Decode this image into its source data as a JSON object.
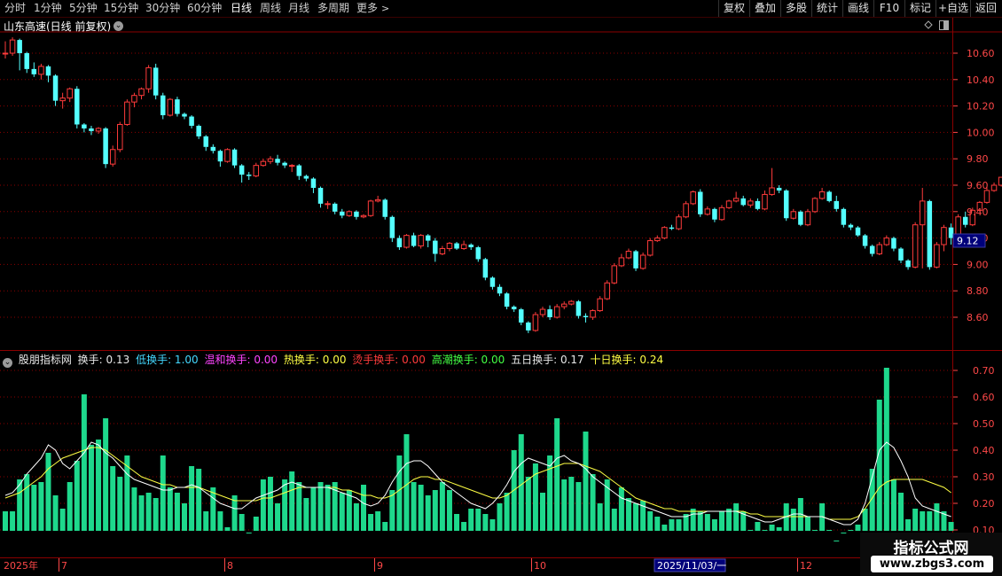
{
  "toolbar": {
    "periods": [
      {
        "label": "分时",
        "active": false
      },
      {
        "label": "1分钟",
        "active": false
      },
      {
        "label": "5分钟",
        "active": false
      },
      {
        "label": "15分钟",
        "active": false
      },
      {
        "label": "30分钟",
        "active": false
      },
      {
        "label": "60分钟",
        "active": false
      },
      {
        "label": "日线",
        "active": true
      },
      {
        "label": "周线",
        "active": false
      },
      {
        "label": "月线",
        "active": false
      },
      {
        "label": "多周期",
        "active": false
      },
      {
        "label": "更多",
        "active": false
      }
    ],
    "right_buttons": [
      "复权",
      "叠加",
      "多股",
      "统计",
      "画线",
      "F10",
      "标记",
      "+自选",
      "返回"
    ]
  },
  "stock": {
    "title": "山东高速(日线 前复权)"
  },
  "price_axis": {
    "ticks": [
      "10.60",
      "10.40",
      "10.20",
      "10.00",
      "9.80",
      "9.60",
      "9.40",
      "9.20",
      "9.00",
      "8.80",
      "8.60"
    ],
    "current_price": "9.12"
  },
  "indicator": {
    "name": "股朋指标网",
    "items": [
      {
        "label": "换手: 0.13",
        "color": "#e8e8e8"
      },
      {
        "label": "低换手: 1.00",
        "color": "#44d8ff"
      },
      {
        "label": "温和换手: 0.00",
        "color": "#ff44ff"
      },
      {
        "label": "热换手: 0.00",
        "color": "#ffff44"
      },
      {
        "label": "烫手换手: 0.00",
        "color": "#ff3b3b"
      },
      {
        "label": "高潮换手: 0.00",
        "color": "#44ff44"
      },
      {
        "label": "五日换手: 0.17",
        "color": "#e8e8e8"
      },
      {
        "label": "十日换手: 0.24",
        "color": "#ffff44"
      }
    ],
    "axis_ticks": [
      "0.70",
      "0.60",
      "0.50",
      "0.40",
      "0.30",
      "0.20",
      "0.10"
    ]
  },
  "time_axis": {
    "labels": [
      "2025年",
      "7",
      "8",
      "9",
      "10",
      "2025/11/03/一",
      "12"
    ]
  },
  "watermark": {
    "title": "指标公式网",
    "url": "www.zbgs3.com"
  },
  "colors": {
    "up": "#ff3b3b",
    "down": "#54ffff",
    "grid": "#8b0000",
    "axis_text": "#ff4848",
    "vol_bar": "#1ed88c",
    "ma5": "#ffffff",
    "ma10": "#ffff44"
  },
  "chart_data": {
    "type": "candlestick",
    "title": "山东高速(日线 前复权)",
    "price_ylim": [
      8.5,
      10.73
    ],
    "candles": [
      [
        10.6,
        10.6,
        10.69,
        10.56
      ],
      [
        10.6,
        10.7,
        10.72,
        10.58
      ],
      [
        10.7,
        10.6,
        10.71,
        10.47
      ],
      [
        10.6,
        10.48,
        10.61,
        10.45
      ],
      [
        10.48,
        10.44,
        10.53,
        10.42
      ],
      [
        10.44,
        10.5,
        10.52,
        10.4
      ],
      [
        10.5,
        10.43,
        10.51,
        10.38
      ],
      [
        10.43,
        10.24,
        10.44,
        10.2
      ],
      [
        10.24,
        10.26,
        10.3,
        10.18
      ],
      [
        10.26,
        10.33,
        10.34,
        10.23
      ],
      [
        10.33,
        10.06,
        10.35,
        10.03
      ],
      [
        10.06,
        10.03,
        10.07,
        10.0
      ],
      [
        10.03,
        10.01,
        10.05,
        9.98
      ],
      [
        10.01,
        10.03,
        10.04,
        9.99
      ],
      [
        10.03,
        9.76,
        10.04,
        9.73
      ],
      [
        9.76,
        9.87,
        9.9,
        9.74
      ],
      [
        9.87,
        10.06,
        10.08,
        9.85
      ],
      [
        10.06,
        10.23,
        10.25,
        10.05
      ],
      [
        10.23,
        10.28,
        10.3,
        10.19
      ],
      [
        10.28,
        10.33,
        10.34,
        10.25
      ],
      [
        10.33,
        10.49,
        10.51,
        10.3
      ],
      [
        10.49,
        10.28,
        10.52,
        10.25
      ],
      [
        10.28,
        10.13,
        10.3,
        10.1
      ],
      [
        10.13,
        10.25,
        10.26,
        10.12
      ],
      [
        10.25,
        10.14,
        10.27,
        10.12
      ],
      [
        10.14,
        10.12,
        10.15,
        10.1
      ],
      [
        10.12,
        10.05,
        10.13,
        10.03
      ],
      [
        10.05,
        9.97,
        10.06,
        9.95
      ],
      [
        9.97,
        9.89,
        9.98,
        9.86
      ],
      [
        9.89,
        9.86,
        9.91,
        9.84
      ],
      [
        9.86,
        9.78,
        9.87,
        9.74
      ],
      [
        9.78,
        9.87,
        9.88,
        9.77
      ],
      [
        9.87,
        9.75,
        9.88,
        9.73
      ],
      [
        9.75,
        9.68,
        9.76,
        9.62
      ],
      [
        9.68,
        9.67,
        9.7,
        9.64
      ],
      [
        9.67,
        9.75,
        9.77,
        9.66
      ],
      [
        9.75,
        9.78,
        9.8,
        9.74
      ],
      [
        9.78,
        9.8,
        9.82,
        9.76
      ],
      [
        9.8,
        9.77,
        9.83,
        9.75
      ],
      [
        9.77,
        9.75,
        9.78,
        9.73
      ],
      [
        9.75,
        9.75,
        9.76,
        9.7
      ],
      [
        9.75,
        9.67,
        9.76,
        9.64
      ],
      [
        9.67,
        9.65,
        9.68,
        9.63
      ],
      [
        9.65,
        9.58,
        9.66,
        9.54
      ],
      [
        9.58,
        9.46,
        9.59,
        9.43
      ],
      [
        9.46,
        9.46,
        9.48,
        9.42
      ],
      [
        9.46,
        9.4,
        9.47,
        9.38
      ],
      [
        9.4,
        9.37,
        9.42,
        9.35
      ],
      [
        9.37,
        9.4,
        9.41,
        9.36
      ],
      [
        9.4,
        9.36,
        9.41,
        9.34
      ],
      [
        9.36,
        9.37,
        9.38,
        9.35
      ],
      [
        9.37,
        9.48,
        9.49,
        9.36
      ],
      [
        9.48,
        9.49,
        9.52,
        9.47
      ],
      [
        9.49,
        9.36,
        9.5,
        9.34
      ],
      [
        9.36,
        9.2,
        9.37,
        9.17
      ],
      [
        9.2,
        9.13,
        9.22,
        9.11
      ],
      [
        9.13,
        9.22,
        9.23,
        9.12
      ],
      [
        9.22,
        9.14,
        9.24,
        9.13
      ],
      [
        9.14,
        9.22,
        9.23,
        9.12
      ],
      [
        9.22,
        9.18,
        9.23,
        9.13
      ],
      [
        9.18,
        9.08,
        9.2,
        9.02
      ],
      [
        9.08,
        9.12,
        9.14,
        9.07
      ],
      [
        9.12,
        9.16,
        9.17,
        9.1
      ],
      [
        9.16,
        9.12,
        9.17,
        9.11
      ],
      [
        9.12,
        9.15,
        9.18,
        9.11
      ],
      [
        9.15,
        9.13,
        9.16,
        9.11
      ],
      [
        9.13,
        9.04,
        9.14,
        9.02
      ],
      [
        9.04,
        8.9,
        9.05,
        8.88
      ],
      [
        8.9,
        8.83,
        8.91,
        8.81
      ],
      [
        8.83,
        8.78,
        8.85,
        8.76
      ],
      [
        8.78,
        8.68,
        8.79,
        8.66
      ],
      [
        8.68,
        8.66,
        8.69,
        8.64
      ],
      [
        8.66,
        8.56,
        8.67,
        8.54
      ],
      [
        8.56,
        8.5,
        8.57,
        8.48
      ],
      [
        8.5,
        8.62,
        8.64,
        8.49
      ],
      [
        8.62,
        8.66,
        8.68,
        8.6
      ],
      [
        8.66,
        8.6,
        8.69,
        8.58
      ],
      [
        8.6,
        8.68,
        8.7,
        8.59
      ],
      [
        8.68,
        8.7,
        8.72,
        8.66
      ],
      [
        8.7,
        8.72,
        8.73,
        8.69
      ],
      [
        8.72,
        8.61,
        8.73,
        8.59
      ],
      [
        8.61,
        8.6,
        8.63,
        8.56
      ],
      [
        8.6,
        8.65,
        8.66,
        8.58
      ],
      [
        8.65,
        8.74,
        8.76,
        8.64
      ],
      [
        8.74,
        8.86,
        8.88,
        8.73
      ],
      [
        8.86,
        8.99,
        9.01,
        8.85
      ],
      [
        8.99,
        9.05,
        9.08,
        8.98
      ],
      [
        9.05,
        9.1,
        9.12,
        9.04
      ],
      [
        9.1,
        8.97,
        9.11,
        8.95
      ],
      [
        8.97,
        9.07,
        9.09,
        8.96
      ],
      [
        9.07,
        9.18,
        9.2,
        9.06
      ],
      [
        9.18,
        9.2,
        9.22,
        9.17
      ],
      [
        9.2,
        9.28,
        9.29,
        9.19
      ],
      [
        9.28,
        9.27,
        9.3,
        9.26
      ],
      [
        9.27,
        9.36,
        9.38,
        9.26
      ],
      [
        9.36,
        9.46,
        9.48,
        9.35
      ],
      [
        9.46,
        9.55,
        9.56,
        9.45
      ],
      [
        9.55,
        9.38,
        9.57,
        9.36
      ],
      [
        9.38,
        9.42,
        9.44,
        9.37
      ],
      [
        9.42,
        9.34,
        9.43,
        9.32
      ],
      [
        9.34,
        9.43,
        9.45,
        9.33
      ],
      [
        9.43,
        9.48,
        9.49,
        9.42
      ],
      [
        9.48,
        9.5,
        9.55,
        9.47
      ],
      [
        9.5,
        9.45,
        9.52,
        9.44
      ],
      [
        9.45,
        9.48,
        9.5,
        9.43
      ],
      [
        9.48,
        9.42,
        9.5,
        9.41
      ],
      [
        9.42,
        9.53,
        9.56,
        9.41
      ],
      [
        9.53,
        9.58,
        9.73,
        9.52
      ],
      [
        9.58,
        9.56,
        9.6,
        9.54
      ],
      [
        9.56,
        9.35,
        9.57,
        9.33
      ],
      [
        9.35,
        9.4,
        9.42,
        9.34
      ],
      [
        9.4,
        9.3,
        9.41,
        9.29
      ],
      [
        9.3,
        9.4,
        9.42,
        9.29
      ],
      [
        9.4,
        9.5,
        9.51,
        9.39
      ],
      [
        9.5,
        9.55,
        9.58,
        9.49
      ],
      [
        9.55,
        9.48,
        9.56,
        9.47
      ],
      [
        9.48,
        9.42,
        9.52,
        9.4
      ],
      [
        9.42,
        9.3,
        9.43,
        9.28
      ],
      [
        9.3,
        9.28,
        9.31,
        9.26
      ],
      [
        9.28,
        9.22,
        9.29,
        9.21
      ],
      [
        9.22,
        9.14,
        9.23,
        9.12
      ],
      [
        9.14,
        9.08,
        9.15,
        9.06
      ],
      [
        9.08,
        9.15,
        9.17,
        9.07
      ],
      [
        9.15,
        9.2,
        9.22,
        9.14
      ],
      [
        9.2,
        9.12,
        9.21,
        9.1
      ],
      [
        9.12,
        9.03,
        9.13,
        9.01
      ],
      [
        9.03,
        8.98,
        9.04,
        8.96
      ],
      [
        8.98,
        9.3,
        9.32,
        8.97
      ],
      [
        9.3,
        9.48,
        9.58,
        8.97
      ],
      [
        9.48,
        8.98,
        9.49,
        8.96
      ],
      [
        8.98,
        9.15,
        9.17,
        8.97
      ],
      [
        9.15,
        9.28,
        9.3,
        9.1
      ],
      [
        9.28,
        9.2,
        9.31,
        9.15
      ],
      [
        9.2,
        9.36,
        9.38,
        9.18
      ],
      [
        9.36,
        9.3,
        9.4,
        9.28
      ],
      [
        9.3,
        9.41,
        9.43,
        9.29
      ],
      [
        9.41,
        9.47,
        9.48,
        9.4
      ],
      [
        9.47,
        9.56,
        9.59,
        9.46
      ],
      [
        9.56,
        9.6,
        9.62,
        9.55
      ],
      [
        9.6,
        9.66,
        9.66,
        9.59
      ]
    ],
    "volume_series": {
      "name": "换手",
      "ylim": [
        0,
        0.73
      ],
      "values": [
        0.17,
        0.17,
        0.29,
        0.31,
        0.27,
        0.28,
        0.39,
        0.23,
        0.18,
        0.28,
        0.36,
        0.61,
        0.42,
        0.44,
        0.52,
        0.34,
        0.3,
        0.38,
        0.26,
        0.23,
        0.24,
        0.22,
        0.38,
        0.26,
        0.24,
        0.2,
        0.34,
        0.33,
        0.17,
        0.26,
        0.17,
        0.11,
        0.23,
        0.16,
        0.09,
        0.15,
        0.29,
        0.3,
        0.2,
        0.29,
        0.32,
        0.28,
        0.22,
        0.26,
        0.28,
        0.27,
        0.28,
        0.24,
        0.25,
        0.2,
        0.27,
        0.16,
        0.17,
        0.13,
        0.25,
        0.38,
        0.46,
        0.28,
        0.27,
        0.23,
        0.25,
        0.28,
        0.25,
        0.16,
        0.13,
        0.18,
        0.18,
        0.16,
        0.14,
        0.2,
        0.24,
        0.4,
        0.46,
        0.3,
        0.35,
        0.24,
        0.38,
        0.52,
        0.29,
        0.3,
        0.28,
        0.47,
        0.31,
        0.2,
        0.29,
        0.18,
        0.26,
        0.22,
        0.2,
        0.21,
        0.17,
        0.15,
        0.12,
        0.14,
        0.14,
        0.16,
        0.18,
        0.17,
        0.16,
        0.14,
        0.17,
        0.18,
        0.2,
        0.17,
        0.1,
        0.13,
        0.1,
        0.12,
        0.11,
        0.2,
        0.18,
        0.22,
        0.15,
        0.1,
        0.2,
        0.1,
        0.06,
        0.09,
        0.1,
        0.12,
        0.18,
        0.33,
        0.59,
        0.71,
        0.29,
        0.24,
        0.14,
        0.18,
        0.17,
        0.17,
        0.2,
        0.17,
        0.13
      ]
    },
    "ma5_values": [
      0.23,
      0.24,
      0.27,
      0.31,
      0.34,
      0.37,
      0.42,
      0.4,
      0.35,
      0.33,
      0.36,
      0.39,
      0.43,
      0.42,
      0.39,
      0.37,
      0.34,
      0.31,
      0.29,
      0.28,
      0.27,
      0.26,
      0.25,
      0.25,
      0.26,
      0.26,
      0.27,
      0.26,
      0.24,
      0.22,
      0.2,
      0.19,
      0.18,
      0.18,
      0.2,
      0.22,
      0.23,
      0.24,
      0.25,
      0.27,
      0.28,
      0.27,
      0.26,
      0.26,
      0.26,
      0.26,
      0.25,
      0.24,
      0.23,
      0.22,
      0.2,
      0.19,
      0.2,
      0.23,
      0.28,
      0.32,
      0.35,
      0.36,
      0.36,
      0.34,
      0.31,
      0.28,
      0.26,
      0.24,
      0.22,
      0.2,
      0.19,
      0.18,
      0.2,
      0.23,
      0.27,
      0.32,
      0.35,
      0.37,
      0.36,
      0.35,
      0.34,
      0.37,
      0.38,
      0.36,
      0.35,
      0.33,
      0.3,
      0.28,
      0.26,
      0.24,
      0.22,
      0.21,
      0.2,
      0.19,
      0.18,
      0.17,
      0.16,
      0.15,
      0.15,
      0.15,
      0.16,
      0.16,
      0.17,
      0.17,
      0.17,
      0.17,
      0.17,
      0.16,
      0.15,
      0.14,
      0.13,
      0.13,
      0.14,
      0.15,
      0.16,
      0.16,
      0.15,
      0.15,
      0.15,
      0.14,
      0.13,
      0.12,
      0.12,
      0.14,
      0.2,
      0.3,
      0.4,
      0.43,
      0.41,
      0.36,
      0.3,
      0.22,
      0.19,
      0.18,
      0.17,
      0.16,
      0.15
    ],
    "ma10_values": [
      0.22,
      0.23,
      0.24,
      0.26,
      0.28,
      0.3,
      0.33,
      0.35,
      0.37,
      0.38,
      0.39,
      0.4,
      0.41,
      0.41,
      0.4,
      0.38,
      0.36,
      0.34,
      0.32,
      0.3,
      0.29,
      0.28,
      0.27,
      0.27,
      0.26,
      0.26,
      0.26,
      0.26,
      0.25,
      0.24,
      0.23,
      0.22,
      0.21,
      0.21,
      0.21,
      0.21,
      0.22,
      0.22,
      0.23,
      0.24,
      0.25,
      0.26,
      0.26,
      0.26,
      0.26,
      0.26,
      0.26,
      0.25,
      0.25,
      0.24,
      0.23,
      0.23,
      0.22,
      0.22,
      0.23,
      0.25,
      0.27,
      0.29,
      0.3,
      0.3,
      0.29,
      0.29,
      0.28,
      0.27,
      0.26,
      0.25,
      0.24,
      0.23,
      0.22,
      0.22,
      0.23,
      0.25,
      0.27,
      0.29,
      0.31,
      0.32,
      0.33,
      0.34,
      0.35,
      0.35,
      0.35,
      0.34,
      0.33,
      0.32,
      0.3,
      0.28,
      0.26,
      0.24,
      0.22,
      0.21,
      0.2,
      0.19,
      0.18,
      0.18,
      0.17,
      0.17,
      0.17,
      0.17,
      0.17,
      0.17,
      0.17,
      0.17,
      0.17,
      0.17,
      0.16,
      0.16,
      0.15,
      0.15,
      0.15,
      0.15,
      0.15,
      0.15,
      0.15,
      0.15,
      0.15,
      0.14,
      0.14,
      0.14,
      0.14,
      0.15,
      0.18,
      0.22,
      0.26,
      0.28,
      0.29,
      0.29,
      0.29,
      0.29,
      0.29,
      0.28,
      0.27,
      0.26,
      0.24
    ]
  }
}
